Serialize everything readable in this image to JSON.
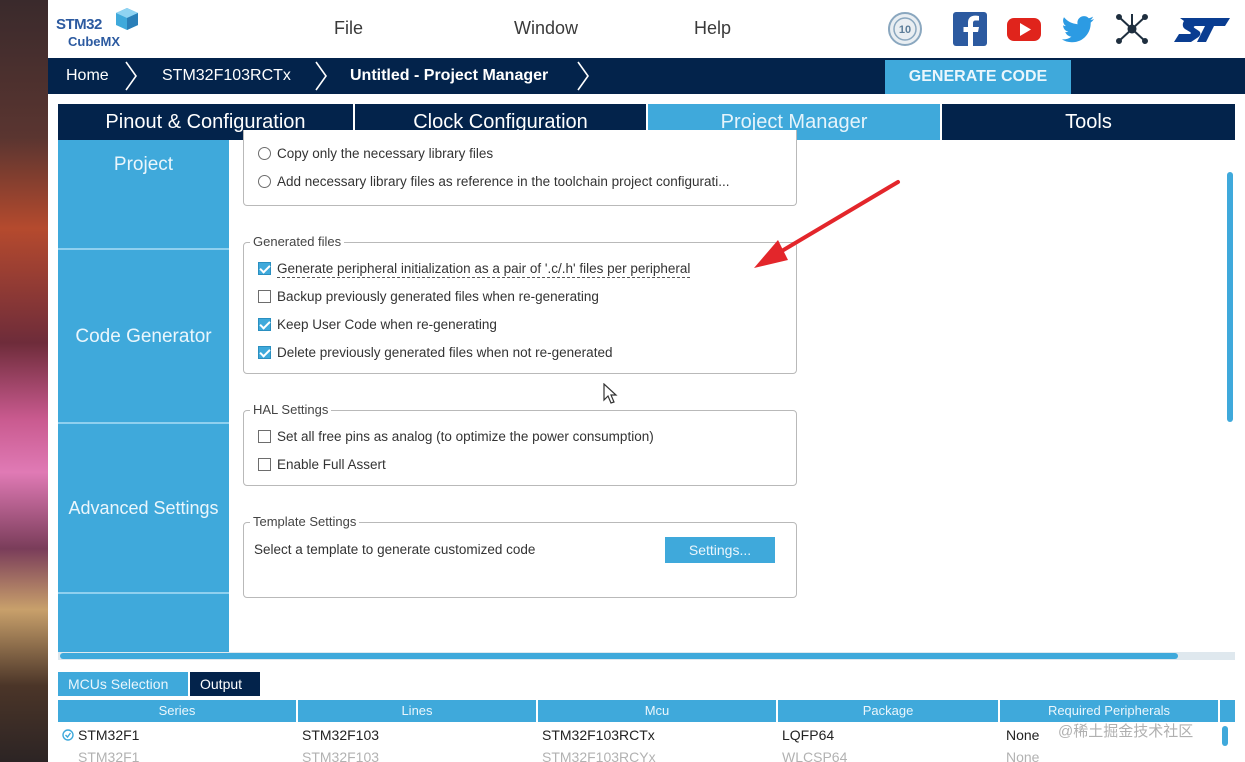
{
  "app": {
    "logo_line1": "STM32",
    "logo_line2": "CubeMX"
  },
  "menu": {
    "file": "File",
    "window": "Window",
    "help": "Help"
  },
  "breadcrumb": {
    "home": "Home",
    "device": "STM32F103RCTx",
    "project": "Untitled - Project Manager",
    "generate": "GENERATE CODE"
  },
  "tabs": [
    {
      "label": "Pinout & Configuration"
    },
    {
      "label": "Clock Configuration"
    },
    {
      "label": "Project Manager"
    },
    {
      "label": "Tools"
    }
  ],
  "sidebar": {
    "items": [
      {
        "label": "Project"
      },
      {
        "label": "Code Generator"
      },
      {
        "label": "Advanced Settings"
      }
    ]
  },
  "library_options": {
    "opt1": "Copy only the necessary library files",
    "opt2": "Add necessary library files as reference in the toolchain project configurati..."
  },
  "generated_files": {
    "title": "Generated files",
    "opt1": "Generate peripheral initialization as a pair of '.c/.h' files per peripheral",
    "opt2": "Backup previously generated files when re-generating",
    "opt3": "Keep User Code when re-generating",
    "opt4": "Delete previously generated files when not re-generated"
  },
  "hal_settings": {
    "title": "HAL Settings",
    "opt1": "Set all free pins as analog (to optimize the power consumption)",
    "opt2": "Enable Full Assert"
  },
  "template_settings": {
    "title": "Template Settings",
    "desc": "Select a template to generate customized code",
    "button": "Settings..."
  },
  "bottom_tabs": {
    "mcu": "MCUs Selection",
    "output": "Output"
  },
  "table": {
    "headers": [
      "Series",
      "Lines",
      "Mcu",
      "Package",
      "Required Peripherals"
    ],
    "row": [
      "STM32F1",
      "STM32F103",
      "STM32F103RCTx",
      "LQFP64",
      "None"
    ],
    "row2": [
      "STM32F1",
      "STM32F103",
      "STM32F103RCYx",
      "WLCSP64",
      "None"
    ]
  },
  "watermark": "@稀土掘金技术社区",
  "colors": {
    "navy": "#03234b",
    "accent": "#3fa9db"
  }
}
